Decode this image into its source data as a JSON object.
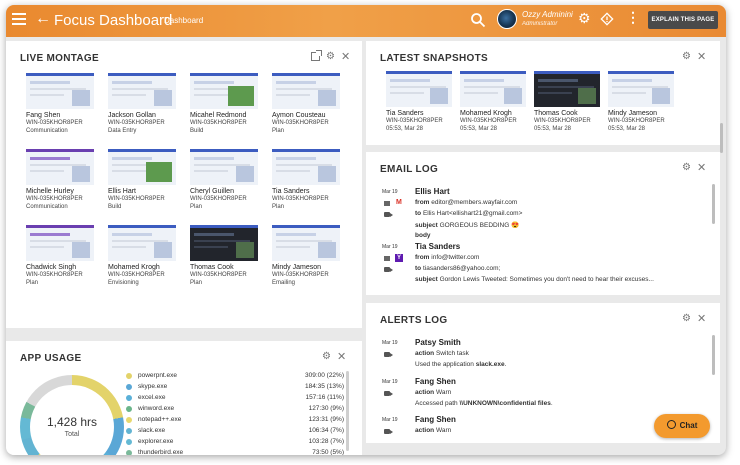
{
  "header": {
    "title": "Focus Dashboard",
    "subtitle": "Dashboard",
    "user_name": "Ozzy Adminini",
    "user_role": "Administrator",
    "explain_label": "EXPLAIN THIS PAGE"
  },
  "montage": {
    "title": "LIVE MONTAGE",
    "tiles": [
      {
        "name": "Fang Shen",
        "machine": "WIN-035KHOR8PER",
        "activity": "Communication"
      },
      {
        "name": "Jackson Gollan",
        "machine": "WIN-035KHOR8PER",
        "activity": "Data Entry"
      },
      {
        "name": "Micahel Redmond",
        "machine": "WIN-035KHOR8PER",
        "activity": "Build"
      },
      {
        "name": "Aymon Cousteau",
        "machine": "WIN-035KHOR8PER",
        "activity": "Plan"
      },
      {
        "name": "Michelle Hurley",
        "machine": "WIN-035KHOR8PER",
        "activity": "Communication"
      },
      {
        "name": "Ellis Hart",
        "machine": "WIN-035KHOR8PER",
        "activity": "Build"
      },
      {
        "name": "Cheryl Guillen",
        "machine": "WIN-035KHOR8PER",
        "activity": "Plan"
      },
      {
        "name": "Tia Sanders",
        "machine": "WIN-035KHOR8PER",
        "activity": "Plan"
      },
      {
        "name": "Chadwick Singh",
        "machine": "WIN-035KHOR8PER",
        "activity": "Plan"
      },
      {
        "name": "Mohamed Krogh",
        "machine": "WIN-035KHOR8PER",
        "activity": "Envisioning"
      },
      {
        "name": "Thomas Cook",
        "machine": "WIN-035KHOR8PER",
        "activity": "Plan"
      },
      {
        "name": "Mindy Jameson",
        "machine": "WIN-035KHOR8PER",
        "activity": "Emailing"
      }
    ]
  },
  "snapshots": {
    "title": "LATEST SNAPSHOTS",
    "items": [
      {
        "name": "Tia Sanders",
        "machine": "WIN-035KHOR8PER",
        "time": "05:53, Mar 28"
      },
      {
        "name": "Mohamed Krogh",
        "machine": "WIN-035KHOR8PER",
        "time": "05:53, Mar 28"
      },
      {
        "name": "Thomas Cook",
        "machine": "WIN-035KHOR8PER",
        "time": "05:53, Mar 28"
      },
      {
        "name": "Mindy Jameson",
        "machine": "WIN-035KHOR8PER",
        "time": "05:53, Mar 28"
      }
    ]
  },
  "email_log": {
    "title": "EMAIL LOG",
    "entries": [
      {
        "date": "Mar 19",
        "name": "Ellis Hart",
        "from_label": "from",
        "from": "editor@members.wayfair.com",
        "to_label": "to",
        "to": "Ellis Hart<ellishart21@gmail.com>",
        "subject_label": "subject",
        "subject": "GORGEOUS BEDDING 😍",
        "body_label": "body"
      },
      {
        "date": "Mar 19",
        "name": "Tia Sanders",
        "from_label": "from",
        "from": "info@twitter.com",
        "to_label": "to",
        "to": "tiasanders86@yahoo.com;",
        "subject_label": "subject",
        "subject": "Gordon Lewis Tweeted: Sometimes you don't need to hear their excuses..."
      }
    ]
  },
  "alerts_log": {
    "title": "ALERTS LOG",
    "entries": [
      {
        "date": "Mar 19",
        "name": "Patsy Smith",
        "action_label": "action",
        "action": "Switch task",
        "detail_prefix": "Used the application ",
        "detail_bold": "slack.exe",
        "detail_suffix": "."
      },
      {
        "date": "Mar 19",
        "name": "Fang Shen",
        "action_label": "action",
        "action": "Warn",
        "detail_prefix": "Accessed path ",
        "detail_bold": "\\\\UNKNOWN\\confidential files",
        "detail_suffix": "."
      },
      {
        "date": "Mar 19",
        "name": "Fang Shen",
        "action_label": "action",
        "action": "Warn"
      }
    ]
  },
  "app_usage": {
    "title": "APP USAGE",
    "total": "1,428 hrs",
    "total_label": "Total",
    "apps": [
      {
        "name": "powerpnt.exe",
        "value": "309:00 (22%)",
        "color": "#e3d36a",
        "fraction": 0.22
      },
      {
        "name": "skype.exe",
        "value": "184:35 (13%)",
        "color": "#5aa7d6",
        "fraction": 0.13
      },
      {
        "name": "excel.exe",
        "value": "157:16 (11%)",
        "color": "#5ab0d8",
        "fraction": 0.11
      },
      {
        "name": "winword.exe",
        "value": "127:30 (9%)",
        "color": "#6ab58a",
        "fraction": 0.09
      },
      {
        "name": "notepad++.exe",
        "value": "123:31 (9%)",
        "color": "#e8d86e",
        "fraction": 0.09
      },
      {
        "name": "slack.exe",
        "value": "106:34 (7%)",
        "color": "#63b4d2",
        "fraction": 0.07
      },
      {
        "name": "explorer.exe",
        "value": "103:28 (7%)",
        "color": "#64b9d4",
        "fraction": 0.07
      },
      {
        "name": "thunderbird.exe",
        "value": "73:50 (5%)",
        "color": "#7ab99a",
        "fraction": 0.05
      }
    ],
    "other_color": "#d8d8d8"
  },
  "chat": {
    "label": "Chat"
  }
}
